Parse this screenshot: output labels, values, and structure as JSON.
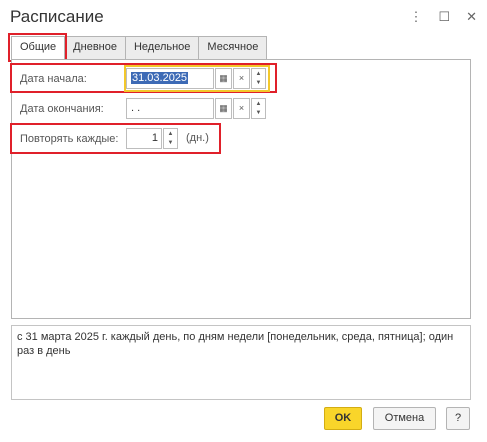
{
  "window": {
    "title": "Расписание",
    "icons": {
      "more": "⋮",
      "maximize": "☐",
      "close": "✕"
    }
  },
  "tabs": [
    {
      "label": "Общие",
      "active": true
    },
    {
      "label": "Дневное",
      "active": false
    },
    {
      "label": "Недельное",
      "active": false
    },
    {
      "label": "Месячное",
      "active": false
    }
  ],
  "form": {
    "start_date_label": "Дата начала:",
    "start_date_value": "31.03.2025",
    "end_date_label": "Дата окончания:",
    "end_date_value": " .  .",
    "repeat_label": "Повторять каждые:",
    "repeat_value": "1",
    "repeat_unit": "(дн.)",
    "clear_glyph": "×",
    "calendar_glyph": "▦"
  },
  "description": "с 31 марта 2025 г. каждый день, по дням недели [понедельник, среда, пятница]; один раз в день",
  "footer": {
    "ok_label": "OK",
    "cancel_label": "Отмена",
    "help_label": "?"
  },
  "colors": {
    "highlight": "#e0202a",
    "ok_button": "#f9d52a",
    "selection": "#3d6ab5"
  }
}
